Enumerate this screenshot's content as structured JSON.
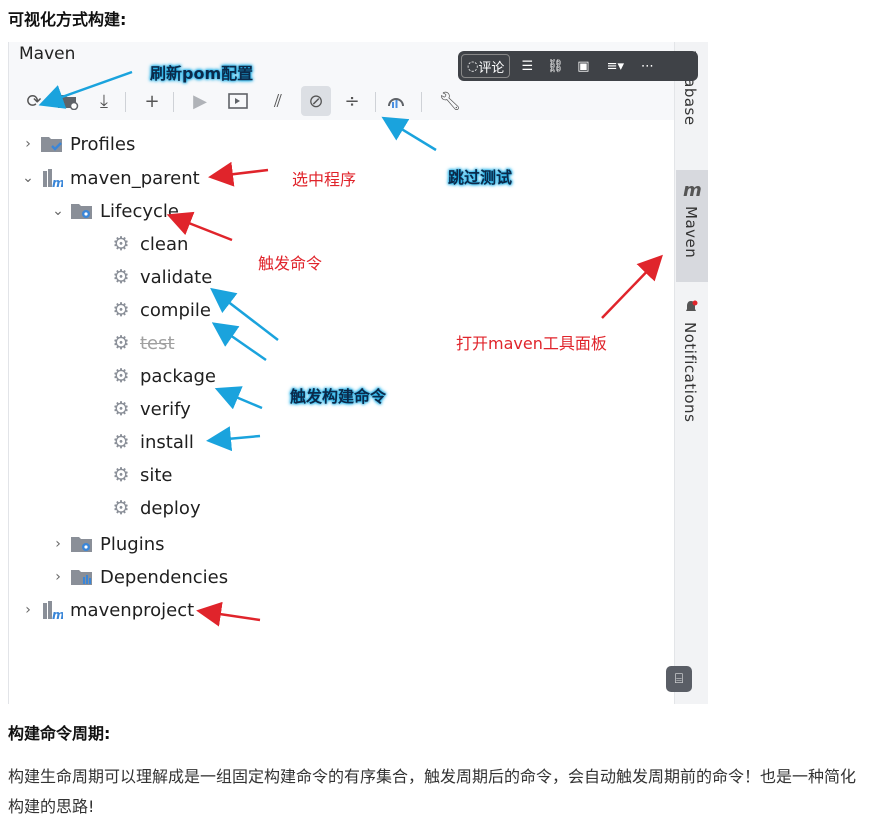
{
  "doc": {
    "heading": "可视化方式构建:",
    "section_title": "构建命令周期:",
    "paragraph": "构建生命周期可以理解成是一组固定构建命令的有序集合，触发周期后的命令，会自动触发周期前的命令！也是一种简化构建的思路!"
  },
  "panel": {
    "title": "Maven",
    "toolbar_icons": [
      "refresh-icon",
      "add-folder-icon",
      "download-icon",
      "plus-icon",
      "run-icon",
      "run-config-icon",
      "toggle-offline-icon",
      "skip-tests-icon",
      "collapse-icon",
      "analyze-icon",
      "settings-wrench-icon"
    ]
  },
  "overlay": {
    "comment_label": "评论"
  },
  "tree": {
    "profiles": "Profiles",
    "maven_parent": "maven_parent",
    "lifecycle": "Lifecycle",
    "phases": [
      "clean",
      "validate",
      "compile",
      "test",
      "package",
      "verify",
      "install",
      "site",
      "deploy"
    ],
    "plugins": "Plugins",
    "dependencies": "Dependencies",
    "mavenproject": "mavenproject"
  },
  "side_tabs": {
    "database": "Database",
    "maven_glyph": "m",
    "maven": "Maven",
    "notifications": "Notifications"
  },
  "annotations": {
    "refresh_pom": "刷新pom配置",
    "skip_test": "跳过测试",
    "select_program": "选中程序",
    "trigger_command": "触发命令",
    "open_maven_panel": "打开maven工具面板",
    "trigger_build_command": "触发构建命令"
  },
  "colors": {
    "annotation_red": "#e0242b",
    "annotation_blue_glow": "#1fb0e8",
    "arrow_blue": "#1aa3dd",
    "arrow_red": "#e0242b"
  }
}
